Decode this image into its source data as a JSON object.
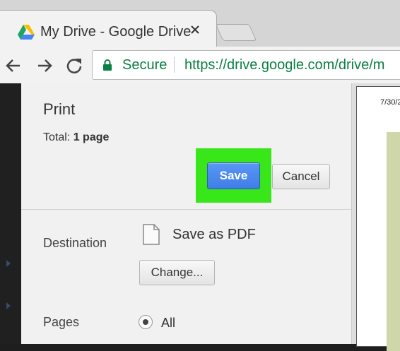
{
  "browser": {
    "tab": {
      "title": "My Drive - Google Drive",
      "icon": "google-drive-icon"
    },
    "address_bar": {
      "secure_label": "Secure",
      "url": "https://drive.google.com/drive/m"
    },
    "nav_icons": [
      "back-arrow-icon",
      "forward-arrow-icon",
      "reload-icon"
    ]
  },
  "print_dialog": {
    "title": "Print",
    "total_label": "Total:",
    "total_value": "1 page",
    "save_label": "Save",
    "cancel_label": "Cancel",
    "destination": {
      "label": "Destination",
      "value": "Save as PDF",
      "change_label": "Change..."
    },
    "pages": {
      "label": "Pages",
      "selected_option": "All"
    }
  },
  "preview": {
    "date_text": "7/30/2"
  },
  "colors": {
    "highlight": "#39e61a",
    "save_button": "#4a86ee",
    "secure_green": "#0b8043",
    "preview_image": "#cfd6a9"
  }
}
